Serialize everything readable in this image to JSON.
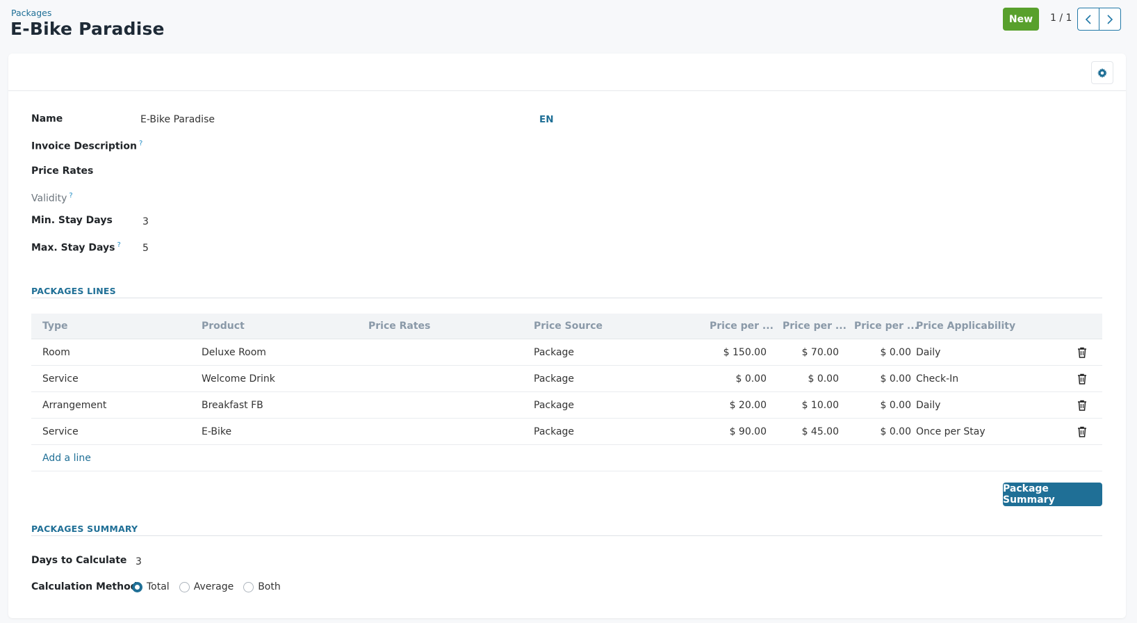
{
  "breadcrumb": "Packages",
  "title": "E-Bike Paradise",
  "toolbar": {
    "new_label": "New",
    "pager_value": "1 / 1"
  },
  "colors": {
    "primary": "#1f6f96",
    "new_button": "#58a02c"
  },
  "icons": {
    "settings": "gear-icon",
    "prev": "chevron-left-icon",
    "next": "chevron-right-icon",
    "delete": "trash-icon"
  },
  "form": {
    "name_label": "Name",
    "name_value": "E-Bike Paradise",
    "lang": "EN",
    "invoice_description_label": "Invoice Description",
    "price_rates_label": "Price Rates",
    "validity_label": "Validity",
    "min_stay_label": "Min. Stay Days",
    "min_stay_value": "3",
    "max_stay_label": "Max. Stay Days",
    "max_stay_value": "5",
    "help_mark": "?"
  },
  "lines": {
    "section_title": "PACKAGES LINES",
    "headers": [
      "Type",
      "Product",
      "Price Rates",
      "Price Source",
      "Price per ...",
      "Price per ...",
      "Price per ...",
      "Price Applicability"
    ],
    "rows": [
      {
        "type": "Room",
        "product": "Deluxe Room",
        "price_rates": "",
        "price_source": "Package",
        "price1": "$ 150.00",
        "price2": "$ 70.00",
        "price3": "$ 0.00",
        "applicability": "Daily"
      },
      {
        "type": "Service",
        "product": "Welcome Drink",
        "price_rates": "",
        "price_source": "Package",
        "price1": "$ 0.00",
        "price2": "$ 0.00",
        "price3": "$ 0.00",
        "applicability": "Check-In"
      },
      {
        "type": "Arrangement",
        "product": "Breakfast FB",
        "price_rates": "",
        "price_source": "Package",
        "price1": "$ 20.00",
        "price2": "$ 10.00",
        "price3": "$ 0.00",
        "applicability": "Daily"
      },
      {
        "type": "Service",
        "product": "E-Bike",
        "price_rates": "",
        "price_source": "Package",
        "price1": "$ 90.00",
        "price2": "$ 45.00",
        "price3": "$ 0.00",
        "applicability": "Once per Stay"
      }
    ],
    "add_line": "Add a line",
    "summary_button": "Package Summary"
  },
  "summary": {
    "section_title": "PACKAGES SUMMARY",
    "days_label": "Days to Calculate",
    "days_value": "3",
    "method_label": "Calculation Method",
    "options": [
      "Total",
      "Average",
      "Both"
    ],
    "selected": "Total"
  }
}
